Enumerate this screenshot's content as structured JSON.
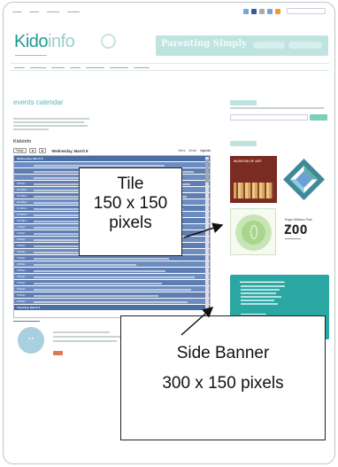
{
  "colors": {
    "brand_teal": "#1f9a8e",
    "calendar_blue": "#5d7db3",
    "banner_teal": "#2aa6a3",
    "callout_border": "#222222"
  },
  "page": {
    "logo": {
      "part1": "Kido",
      "part2": "info"
    },
    "header_banner": "Parenting Simply"
  },
  "events": {
    "title": "events calendar",
    "subtitle": "Kidoinfo",
    "toolbar": {
      "today_label": "Today",
      "date_label": "Wednesday, March 8",
      "view_week": "Week",
      "view_month": "Month",
      "view_agenda": "Agenda"
    },
    "rows": [
      {
        "type": "head",
        "label": "Wednesday, March 8"
      },
      {
        "type": "event",
        "time": ""
      },
      {
        "type": "event",
        "time": ""
      },
      {
        "type": "event",
        "time": ""
      },
      {
        "type": "event",
        "time": "9:00am"
      },
      {
        "type": "event",
        "time": "10:00am"
      },
      {
        "type": "event",
        "time": "10:00am"
      },
      {
        "type": "event",
        "time": "10:30am"
      },
      {
        "type": "event",
        "time": "11:00am"
      },
      {
        "type": "event",
        "time": "11:00am"
      },
      {
        "type": "event",
        "time": "12:00pm"
      },
      {
        "type": "event",
        "time": "1:00pm"
      },
      {
        "type": "event",
        "time": "1:00pm"
      },
      {
        "type": "event",
        "time": "2:00pm"
      },
      {
        "type": "event",
        "time": "3:00pm"
      },
      {
        "type": "event",
        "time": "3:00pm"
      },
      {
        "type": "event",
        "time": "3:30pm"
      },
      {
        "type": "event",
        "time": "4:00pm"
      },
      {
        "type": "event",
        "time": "4:00pm"
      },
      {
        "type": "event",
        "time": "4:00pm"
      },
      {
        "type": "event",
        "time": "4:30pm"
      },
      {
        "type": "event",
        "time": "5:00pm"
      },
      {
        "type": "event",
        "time": "5:30pm"
      },
      {
        "type": "event",
        "time": "6:00pm"
      },
      {
        "type": "head",
        "label": "Thursday, March 9"
      }
    ]
  },
  "ads": {
    "bookfair_text": "MUSEUM OF ART",
    "zoo_line1": "Roger Williams Park",
    "zoo_line2": "ZOO"
  },
  "callouts": {
    "tile": {
      "line1": "Tile",
      "line2": "150 x 150",
      "line3": "pixels"
    },
    "banner": {
      "line1": "Side Banner",
      "line2": "300 x 150 pixels"
    }
  },
  "icons": {
    "diamond": "diamond-logo-icon",
    "tile_badge": "leaf-circle-icon"
  }
}
